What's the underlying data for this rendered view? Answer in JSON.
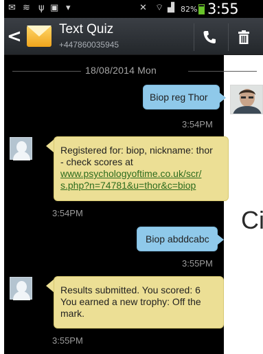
{
  "status_bar": {
    "battery_percent": "82%",
    "time": "3:55 PM",
    "icons": [
      "mail-icon",
      "wifi-signal-icon",
      "usb-icon",
      "sms-icon",
      "download-icon",
      "mute-icon",
      "wifi-icon",
      "cellular-signal-icon",
      "battery-icon"
    ]
  },
  "action_bar": {
    "title": "Text Quiz",
    "subtitle": "+447860035945",
    "icons": [
      "back-icon",
      "envelope-avatar-icon",
      "phone-icon",
      "trash-icon"
    ]
  },
  "conversation": {
    "date_divider": "18/08/2014 Mon",
    "messages": [
      {
        "direction": "outgoing",
        "text": "Biop reg Thor",
        "time": "3:54PM"
      },
      {
        "direction": "incoming",
        "text_lines": [
          "Registered for: biop, nickname: thor",
          "- check scores at"
        ],
        "link_lines": [
          "www.psychologyoftime.co.uk/scr/",
          "s.php?n=74781&u=thor&c=biop"
        ],
        "time": "3:54PM"
      },
      {
        "direction": "outgoing",
        "text": "Biop abddcabc",
        "time": "3:55PM"
      },
      {
        "direction": "incoming",
        "text_lines": [
          "Results submitted. You scored: 6",
          "You earned a new trophy: Off the",
          "mark."
        ],
        "time": "3:55PM"
      }
    ]
  },
  "background_page": {
    "text": "Ci"
  },
  "colors": {
    "outgoing_bubble": "#8fc9ea",
    "incoming_bubble": "#ecdf95",
    "screen_bg": "#000000",
    "link": "#2c6b1d"
  }
}
